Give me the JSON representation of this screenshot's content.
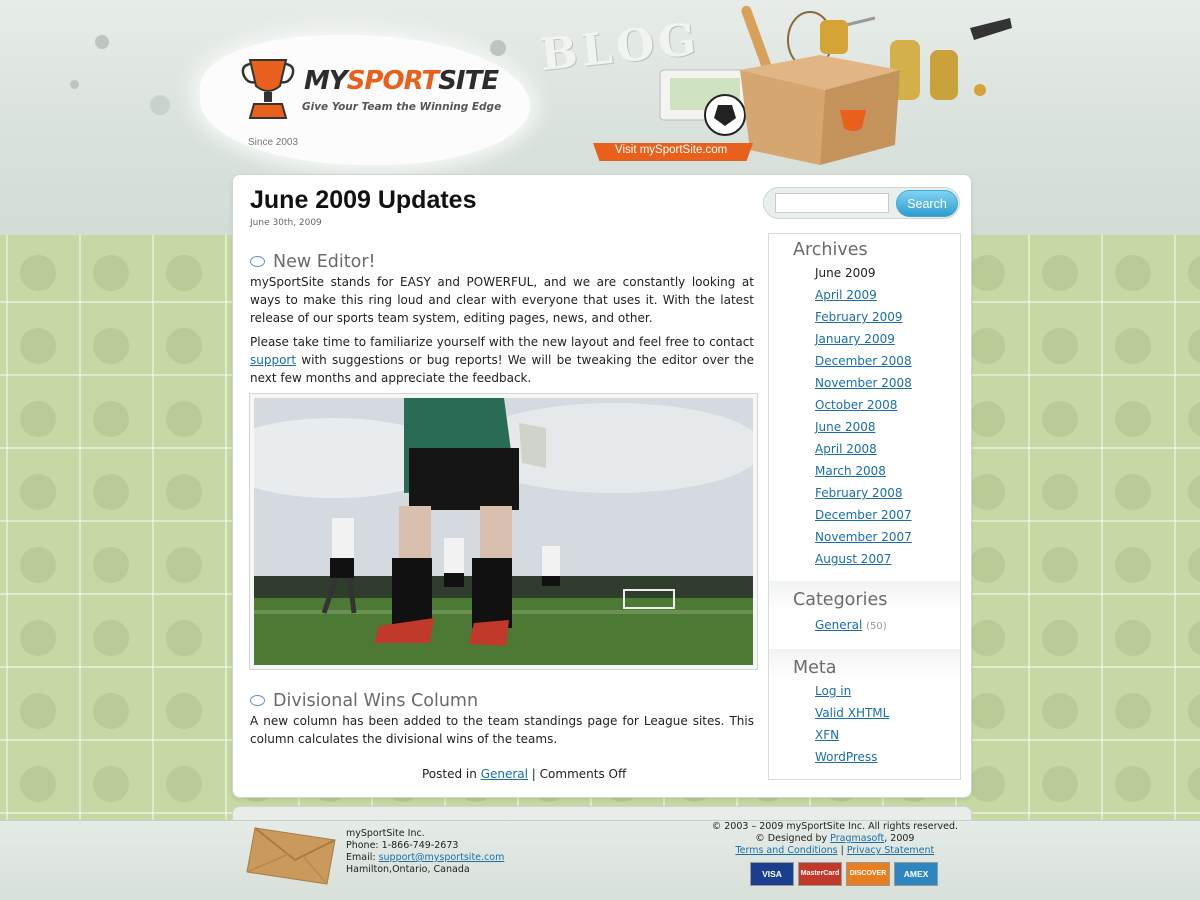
{
  "header": {
    "logo_my": "MY",
    "logo_sport": "SPORT",
    "logo_site": "SITE",
    "tagline": "Give Your Team the Winning Edge",
    "since": "Since 2003",
    "blog_label": "BLOG",
    "visit_link": "Visit mySportSite.com"
  },
  "search": {
    "placeholder": "",
    "button_label": "Search"
  },
  "post": {
    "title": "June 2009 Updates",
    "date": "June 30th, 2009",
    "sections": [
      {
        "heading": "New Editor!",
        "paragraph1": "mySportSite stands for EASY and POWERFUL, and we are constantly looking at ways to make this ring loud and clear with everyone that uses it. With the latest release of our sports team system, editing pages, news, and other.",
        "paragraph2_before": "Please take time to familiarize yourself with the new layout and feel free to contact ",
        "paragraph2_link": "support",
        "paragraph2_after": " with suggestions or bug reports! We will be tweaking the editor over the next few months and appreciate the feedback."
      },
      {
        "heading": "Divisional Wins Column",
        "paragraph1": "A new column has been added to the team standings page for League sites. This column calculates the divisional wins of the teams."
      }
    ],
    "meta_posted_in": "Posted in ",
    "meta_category": "General",
    "meta_comments": "Comments Off"
  },
  "sidebar": {
    "archives_title": "Archives",
    "archives": [
      "June 2009",
      "April 2009",
      "February 2009",
      "January 2009",
      "December 2008",
      "November 2008",
      "October 2008",
      "June 2008",
      "April 2008",
      "March 2008",
      "February 2008",
      "December 2007",
      "November 2007",
      "August 2007"
    ],
    "categories_title": "Categories",
    "categories": [
      {
        "name": "General",
        "count": "(50)"
      }
    ],
    "meta_title": "Meta",
    "meta": [
      "Log in",
      "Valid XHTML",
      "XFN",
      "WordPress"
    ]
  },
  "footer": {
    "company": "mySportSite Inc.",
    "phone": "Phone: 1-866-749-2673",
    "email_label": "Email: ",
    "email": "support@mysportsite.com",
    "location": "Hamilton,Ontario, Canada",
    "copyright": "© 2003 – 2009 mySportSite Inc. All rights reserved.",
    "designed_by": "© Designed by ",
    "designer": "Pragmasoft",
    "designed_year": ", 2009",
    "terms": "Terms and Conditions",
    "privacy": "Privacy Statement",
    "cards": [
      "VISA",
      "MasterCard",
      "DISCOVER",
      "AMEX"
    ]
  },
  "colors": {
    "accent_orange": "#e8601b",
    "link_blue": "#1a6fa8",
    "search_button": "#2f9ccd",
    "pattern_green": "#c6d8a3"
  }
}
